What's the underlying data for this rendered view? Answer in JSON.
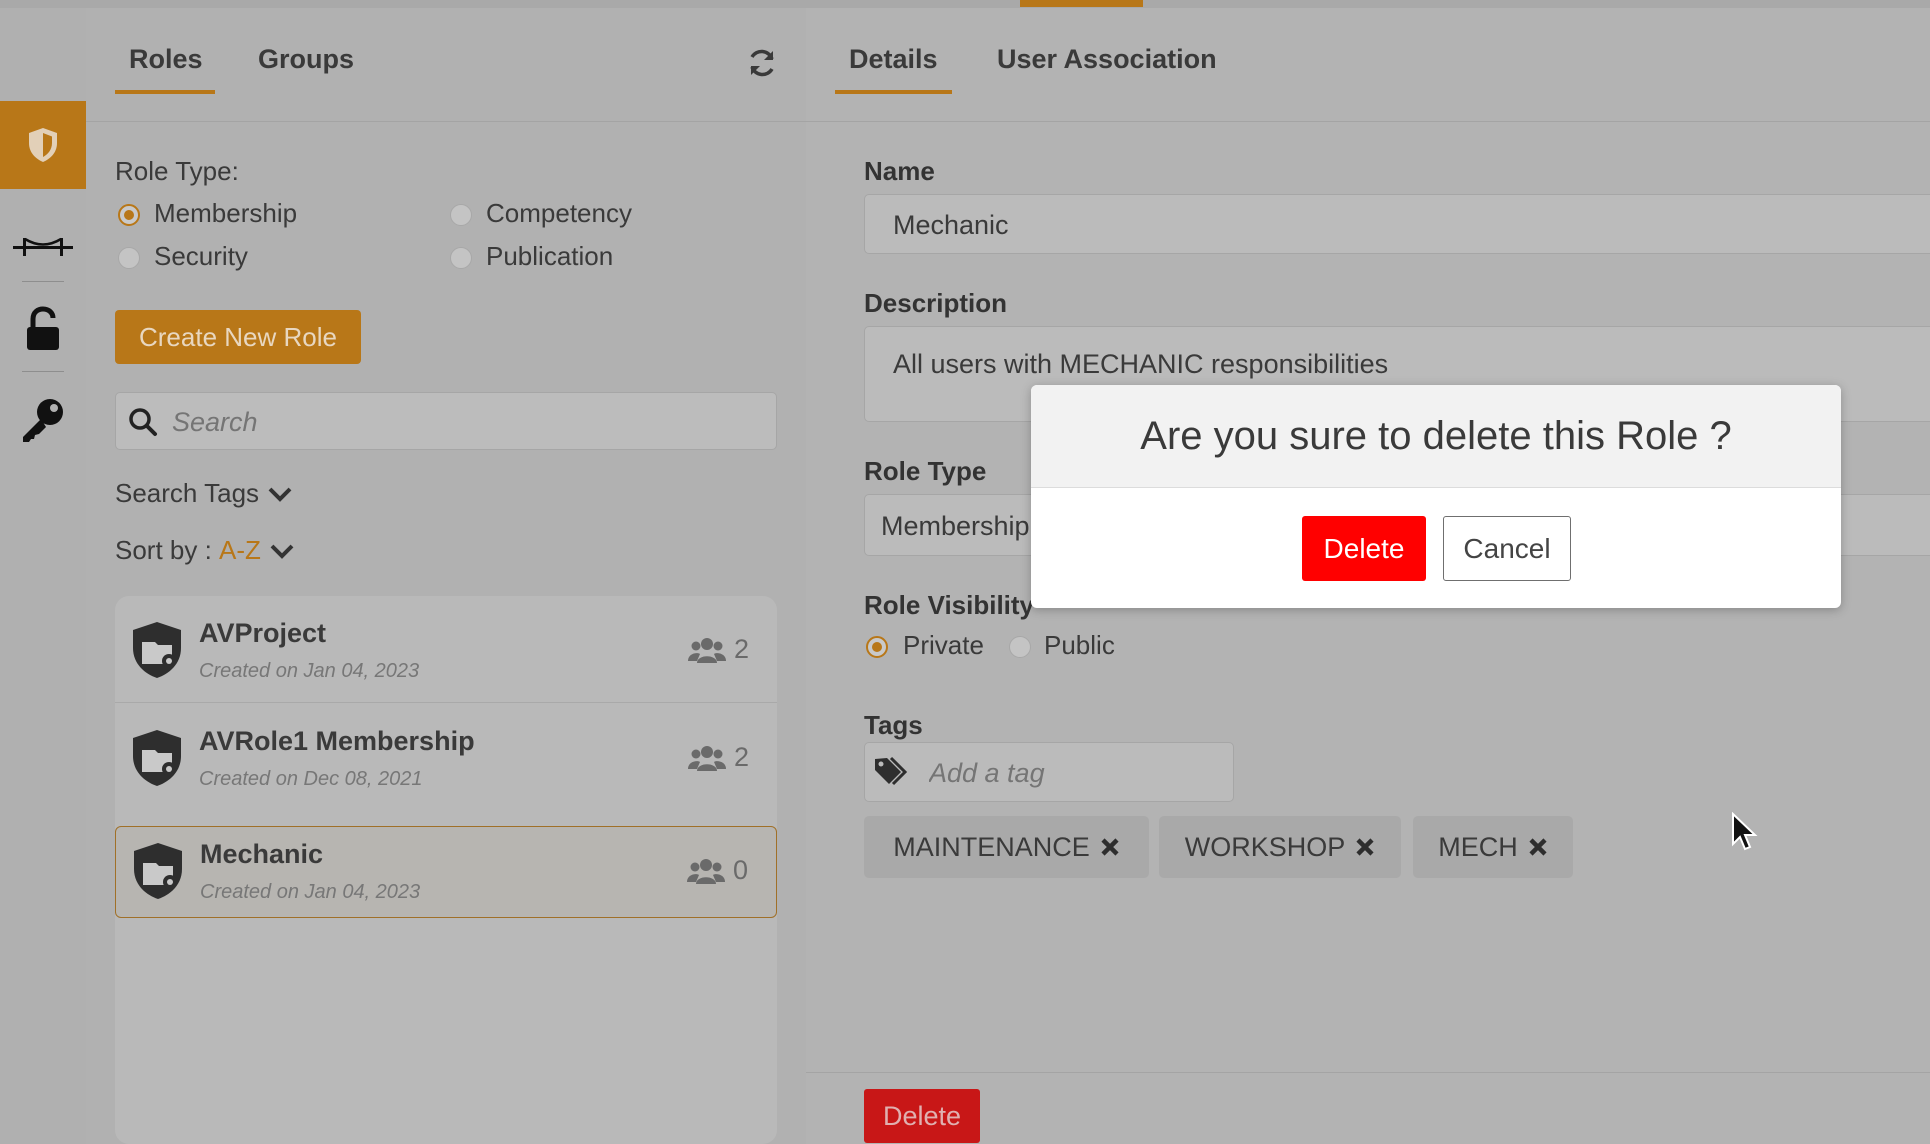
{
  "colors": {
    "accent": "#b87718",
    "danger": "#ff0000",
    "overlay_gray": "#b3b3b3"
  },
  "rail": {
    "items": [
      {
        "icon": "shield-icon",
        "active": true
      },
      {
        "icon": "bridge-icon"
      },
      {
        "icon": "unlock-icon"
      },
      {
        "icon": "key-icon"
      }
    ]
  },
  "left_panel": {
    "tabs": [
      {
        "label": "Roles"
      },
      {
        "label": "Groups"
      }
    ],
    "active_tab": "Roles",
    "refresh_icon": "refresh-icon",
    "role_type_label": "Role Type:",
    "role_types": [
      {
        "label": "Membership",
        "selected": true
      },
      {
        "label": "Competency",
        "selected": false
      },
      {
        "label": "Security",
        "selected": false
      },
      {
        "label": "Publication",
        "selected": false
      }
    ],
    "create_button": "Create New Role",
    "search": {
      "placeholder": "Search",
      "value": ""
    },
    "search_tags_label": "Search Tags",
    "sort_label": "Sort by : ",
    "sort_value": "A-Z",
    "roles": [
      {
        "name": "AVProject",
        "created": "Created on Jan 04, 2023",
        "members": "2",
        "selected": false
      },
      {
        "name": "AVRole1 Membership",
        "created": "Created on Dec 08, 2021",
        "members": "2",
        "selected": false
      },
      {
        "name": "Mechanic",
        "created": "Created on Jan 04, 2023",
        "members": "0",
        "selected": true
      }
    ]
  },
  "right_panel": {
    "tabs": [
      {
        "label": "Details"
      },
      {
        "label": "User Association"
      }
    ],
    "active_tab": "Details",
    "name_label": "Name",
    "name_value": "Mechanic",
    "description_label": "Description",
    "description_value": "All users with MECHANIC responsibilities",
    "role_type_label": "Role Type",
    "role_type_value": "Membership",
    "visibility_label": "Role Visibility",
    "visibility_options": [
      {
        "label": "Private",
        "selected": true
      },
      {
        "label": "Public",
        "selected": false
      }
    ],
    "tags_label": "Tags",
    "tag_placeholder": "Add a tag",
    "tags": [
      "MAINTENANCE",
      "WORKSHOP",
      "MECH"
    ],
    "delete_button": "Delete"
  },
  "modal": {
    "title": "Are you sure to delete this Role ?",
    "confirm_label": "Delete",
    "cancel_label": "Cancel"
  }
}
